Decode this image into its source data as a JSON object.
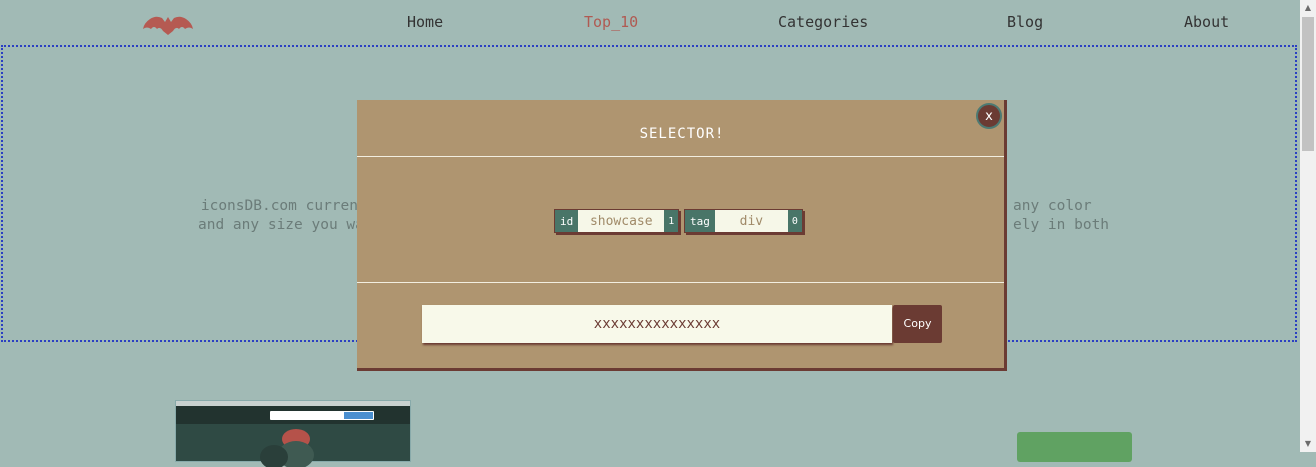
{
  "nav": {
    "links": [
      {
        "label": "Home"
      },
      {
        "label": "Top_10"
      },
      {
        "label": "Categories"
      },
      {
        "label": "Blog"
      },
      {
        "label": "About"
      }
    ],
    "active": "Top_10"
  },
  "showcase": {
    "text_left_line1": "iconsDB.com curren",
    "text_left_line2": "and any size you wa",
    "text_right_line1": "any color",
    "text_right_line2": "ely in both"
  },
  "modal": {
    "title": "SELECTOR!",
    "close_label": "x",
    "chips": [
      {
        "type": "id",
        "value": "showcase",
        "count": "1"
      },
      {
        "type": "tag",
        "value": "div",
        "count": "0"
      }
    ],
    "selector_value": "xxxxxxxxxxxxxxx",
    "copy_label": "Copy"
  },
  "colors": {
    "background": "#a1bab5",
    "modal_bg": "#af9570",
    "accent_dark": "#6b3b33",
    "chip_teal": "#497568",
    "active_link": "#b05a52",
    "showcase_border": "#2b3fc2"
  },
  "icons": {
    "logo": "bat-logo",
    "close": "close-icon"
  }
}
